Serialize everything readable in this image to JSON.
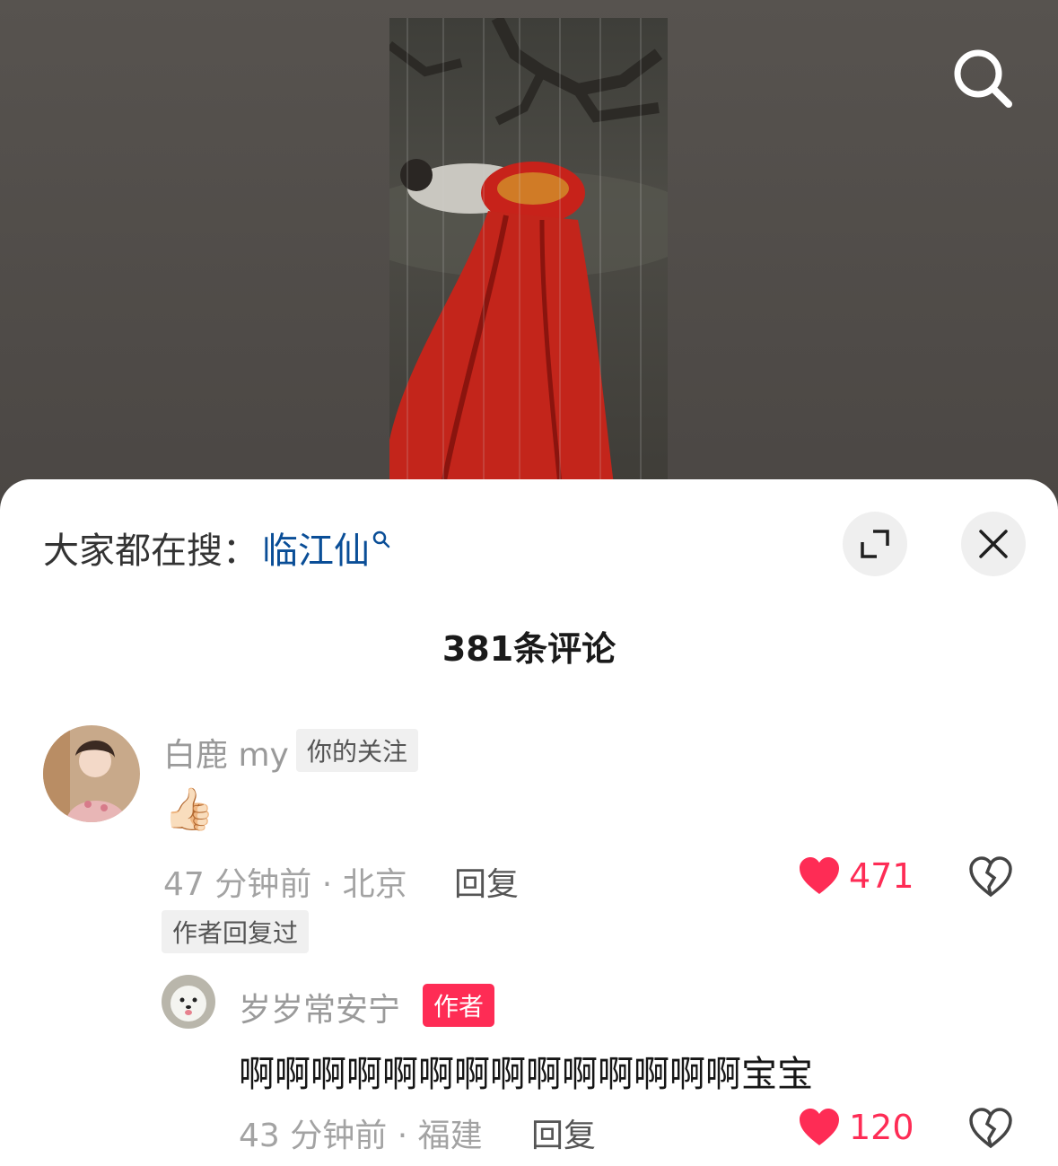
{
  "video": {
    "search_icon": "search-icon"
  },
  "panel": {
    "trending_label": "大家都在搜：",
    "trending_term": "临江仙",
    "expand_icon": "expand-icon",
    "close_icon": "close-icon",
    "comment_count_title": "381条评论"
  },
  "comments": [
    {
      "username": "白鹿 my",
      "badge": "你的关注",
      "text": "👍🏻",
      "time_location": "47 分钟前 · 北京",
      "reply_label": "回复",
      "like_count": "471",
      "author_replied": "作者回复过",
      "replies": [
        {
          "username": "岁岁常安宁",
          "badge": "作者",
          "text": "啊啊啊啊啊啊啊啊啊啊啊啊啊啊宝宝",
          "time_location": "43 分钟前 · 福建",
          "reply_label": "回复",
          "like_count": "120"
        }
      ]
    }
  ],
  "colors": {
    "accent_red": "#fe2c55",
    "link_blue": "#0a4e97"
  }
}
